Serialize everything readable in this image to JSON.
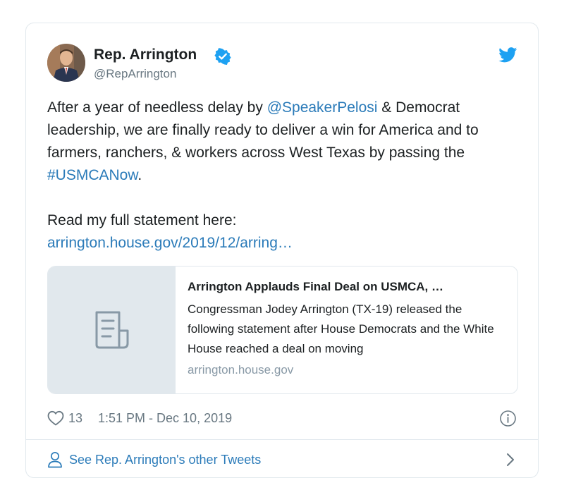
{
  "author": {
    "display_name": "Rep. Arrington",
    "handle": "@RepArrington",
    "verified": true,
    "avatar_icon": "profile-photo"
  },
  "brand": {
    "icon": "twitter-bird-icon",
    "color": "#1da1f2"
  },
  "tweet": {
    "part1": "After a year of needless delay by ",
    "mention": "@SpeakerPelosi",
    "part2": " & Democrat leadership, we are finally ready to deliver a win for America and to farmers, ranchers, & workers across West Texas by passing the ",
    "hashtag": "#USMCANow",
    "part3": ".",
    "line2": "Read my full statement here:",
    "url": "arrington.house.gov/2019/12/arring…"
  },
  "preview": {
    "title": "Arrington Applauds Final Deal on USMCA, …",
    "description": "Congressman Jodey Arrington (TX-19) released the following statement after House Democrats and the White House reached a deal on moving",
    "domain": "arrington.house.gov",
    "icon": "document-icon"
  },
  "meta": {
    "like_count": "13",
    "timestamp": "1:51 PM - Dec 10, 2019"
  },
  "footer": {
    "label": "See Rep. Arrington's other Tweets"
  },
  "colors": {
    "link": "#2b7bb9",
    "text": "#1c2022",
    "secondary": "#697882",
    "border": "#e1e8ed",
    "verified": "#1da1f2"
  }
}
